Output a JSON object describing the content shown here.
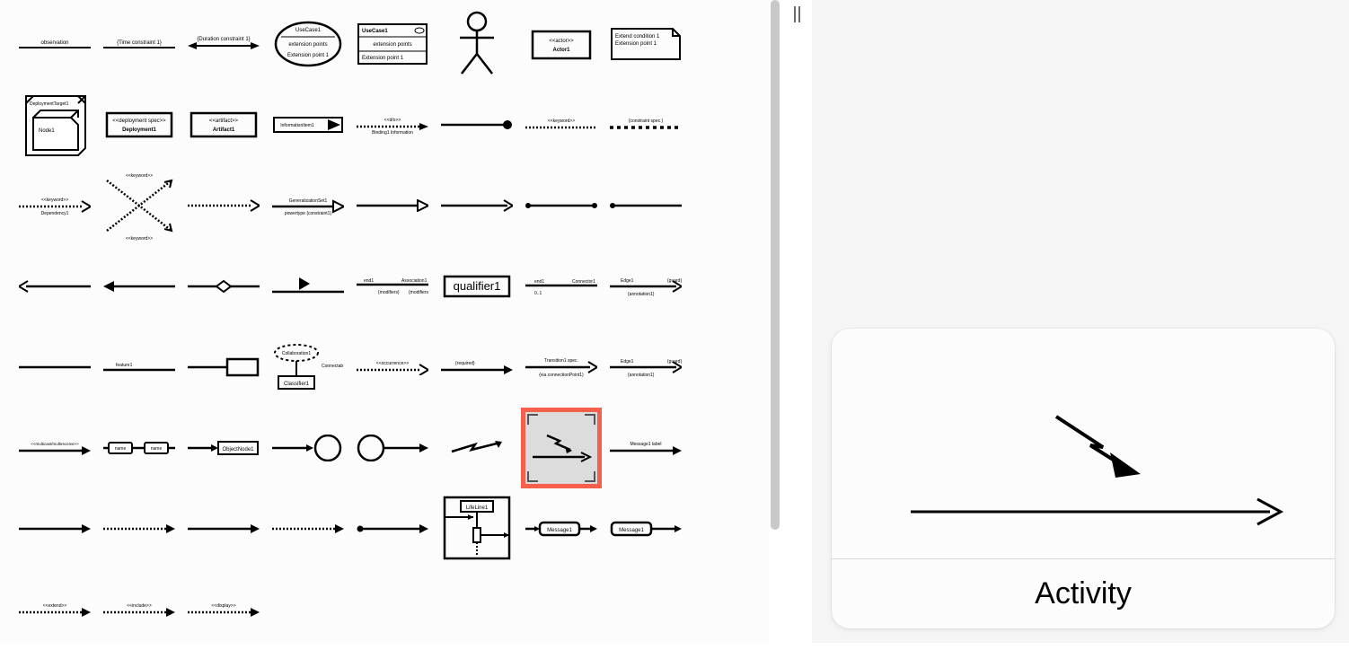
{
  "preview": {
    "title": "Activity"
  },
  "row0": {
    "observation": "observation",
    "time_constraint": "{Time constraint 1}",
    "duration_constraint": "{Duration constraint 1}",
    "usecase_ext": "extension points",
    "usecase_extpt": "Extension point 1",
    "usecase_box_title": "UseCase1",
    "usecase_box_ext": "extension points",
    "usecase_box_extpt": "Extension point 1",
    "actor_stereo": "<<actor>>",
    "actor_name": "Actor1",
    "extend_cond": "Extend condition 1",
    "extend_pt": "Extension point 1"
  },
  "row1": {
    "target": "DeploymentTarget1",
    "node": "Node1",
    "deploy_stereo": "<<deployment spec>>",
    "deploy_name": "Deployment1",
    "artifact_stereo": "<<artifact>>",
    "artifact_name": "Artifact1",
    "info_item": "InformationItem1",
    "dflow_stereo": "<<d/o>>",
    "dflow_lab": "Binding1 Information",
    "keyword": "<<keyword>>",
    "constraint_spec": "{constraint spec.}"
  },
  "row2": {
    "dep_key": "<<keyword>>",
    "dep_name": "Dependency1",
    "xkey1": "<<keyword>>",
    "xkey2": "<<keyword>>",
    "genset": "GeneralizationSet1",
    "powertype": "powertype {constraint1}"
  },
  "row3": {
    "q_a": "end1",
    "q_b": "{modifiers}",
    "q_c": "Association1",
    "q_d": "{modifiers}",
    "qualifier": "qualifier1",
    "conn_a": "end1",
    "conn_b": "0..1",
    "conn_name": "Connector1",
    "edge_a": "Edge1",
    "edge_b": "{annotation1}",
    "edge_c": "{guard}"
  },
  "row4": {
    "feature": "feature1",
    "collab": "Collaboration1",
    "conn_elem": "ConnectableElement",
    "classifier": "Classifier1",
    "occurrence": "<<occurrence>>",
    "required": "{required}",
    "trans_spec": "Transition1 spec.",
    "trans_via": "(via connectionPoint1)"
  },
  "row5": {
    "multicast": "<<multicast/multireceive>>",
    "objnode_a": "name",
    "objnode_b": "name",
    "objnode_c": "ObjectNode1",
    "msg_label": "Message1 label"
  },
  "row6": {
    "lifeline": "LifeLine1",
    "msg1": "Message1",
    "msg2": "Message1"
  },
  "row7": {
    "extend": "<<extend>>",
    "include": "<<include>>",
    "display": "<<display>>"
  }
}
